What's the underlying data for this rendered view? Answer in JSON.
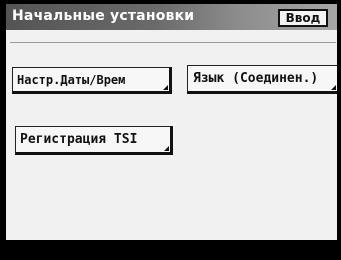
{
  "header": {
    "title": "Начальные установки",
    "enter_label": "Ввод"
  },
  "buttons": {
    "date_time": "Настр.Даты/Врем",
    "language": "Язык (Соединен.)",
    "tsi_registration": "Регистрация TSI"
  }
}
